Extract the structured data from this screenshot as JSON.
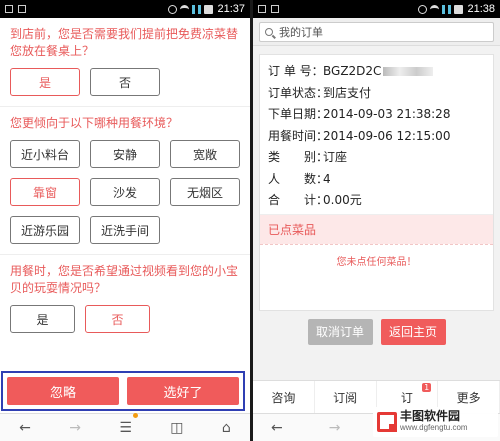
{
  "status": {
    "time_left": "21:37",
    "time_right": "21:38"
  },
  "survey": {
    "q1": {
      "text": "到店前，您是否需要我们提前把免费凉菜替您放在餐桌上？",
      "options": [
        "是",
        "否"
      ],
      "selected": "是"
    },
    "q2": {
      "text": "您更倾向于以下哪种用餐环境？",
      "options": [
        "近小料台",
        "安静",
        "宽敞",
        "靠窗",
        "沙发",
        "无烟区",
        "近游乐园",
        "近洗手间"
      ],
      "selected": "靠窗"
    },
    "q3": {
      "text": "用餐时，您是否希望通过视频看到您的小宝贝的玩耍情况吗？",
      "options": [
        "是",
        "否"
      ],
      "selected": "否"
    },
    "actions": {
      "ignore": "忽略",
      "done": "选好了"
    }
  },
  "left_nav": {
    "back": "←",
    "forward": "→",
    "menu": "☰",
    "tabs": "◫",
    "home": "⌂"
  },
  "order": {
    "search_placeholder": "我的订单",
    "rows": [
      {
        "label": "订 单 号：",
        "value": "BGZ2D2C"
      },
      {
        "label": "订单状态：",
        "value": "到店支付"
      },
      {
        "label": "下单日期：",
        "value": "2014-09-03 21:38:28"
      },
      {
        "label": "用餐时间：",
        "value": "2014-09-06 12:15:00"
      },
      {
        "label": "类　　别：",
        "value": "订座"
      },
      {
        "label": "人　　数：",
        "value": "4"
      },
      {
        "label": "合　　计：",
        "value": "0.00元"
      }
    ],
    "ordered_header": "已点菜品",
    "empty_text": "您未点任何菜品！",
    "cancel": "取消订单",
    "home": "返回主页",
    "tabs": [
      {
        "label": "咨询"
      },
      {
        "label": "订阅"
      },
      {
        "label": "订",
        "badge": "1"
      },
      {
        "label": "更多"
      }
    ]
  },
  "right_nav": {
    "back": "←",
    "forward": "→"
  },
  "watermark": {
    "title": "丰图软件园",
    "url": "www.dgfengtu.com"
  },
  "colors": {
    "accent": "#f05b5b",
    "highlight_border": "#2f3fb3"
  }
}
